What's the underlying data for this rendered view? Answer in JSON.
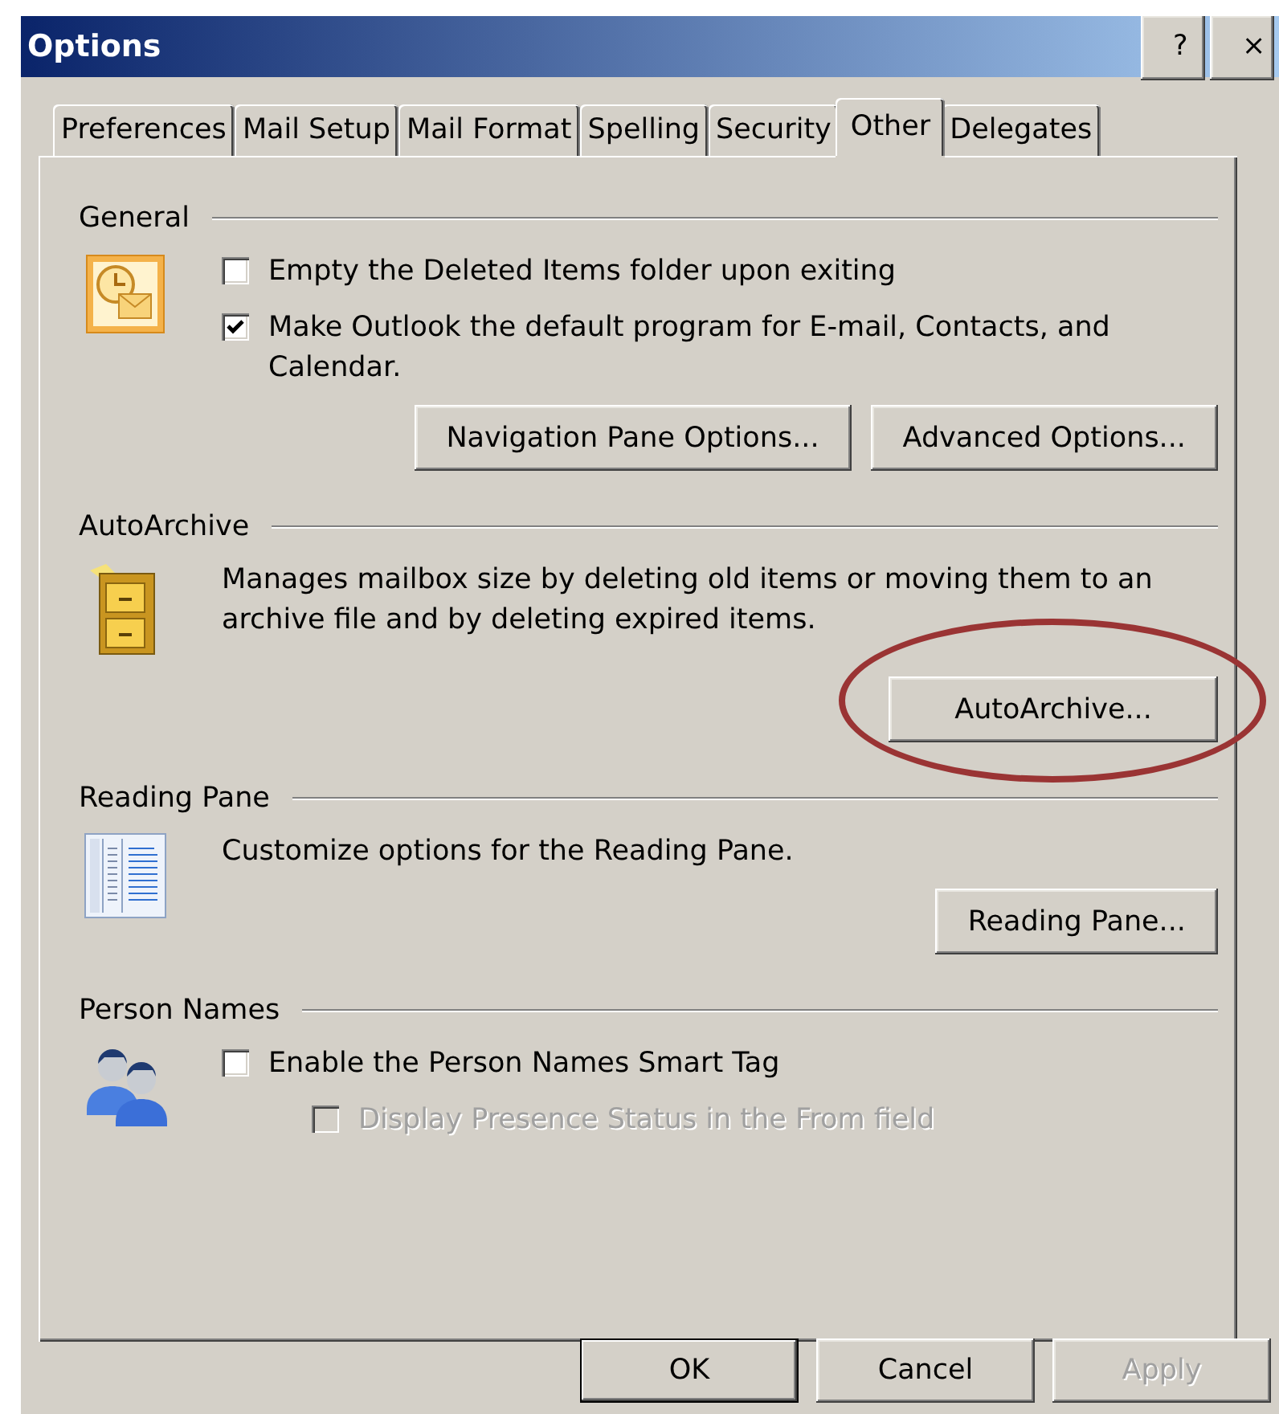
{
  "window": {
    "title": "Options",
    "title_buttons": [
      "?",
      "×"
    ]
  },
  "tabs": [
    {
      "label": "Preferences",
      "selected": false
    },
    {
      "label": "Mail Setup",
      "selected": false
    },
    {
      "label": "Mail Format",
      "selected": false
    },
    {
      "label": "Spelling",
      "selected": false
    },
    {
      "label": "Security",
      "selected": false
    },
    {
      "label": "Other",
      "selected": true
    },
    {
      "label": "Delegates",
      "selected": false
    }
  ],
  "sections": [
    {
      "title": "General",
      "kind": "general",
      "rows": [
        {
          "kind": "checkbox",
          "label": "Empty the Deleted Items folder upon exiting",
          "checked": false,
          "disabled": false
        },
        {
          "kind": "checkbox",
          "label": "Make Outlook the default program for E-mail, Contacts, and Calendar.",
          "checked": true,
          "disabled": false
        },
        {
          "kind": "buttons",
          "buttons": [
            "Navigation Pane Options...",
            "Advanced Options..."
          ]
        }
      ]
    },
    {
      "title": "AutoArchive",
      "kind": "autoarchive",
      "rows": [
        {
          "kind": "text",
          "text": "Manages mailbox size by deleting old items or moving them to an archive file and by deleting expired items."
        },
        {
          "kind": "buttons",
          "buttons": [
            "AutoArchive..."
          ],
          "highlighted": true
        }
      ]
    },
    {
      "title": "Reading Pane",
      "kind": "reading-pane",
      "rows": [
        {
          "kind": "text",
          "text": "Customize options for the Reading Pane."
        },
        {
          "kind": "buttons",
          "buttons": [
            "Reading Pane..."
          ]
        }
      ]
    },
    {
      "title": "Person Names",
      "kind": "person-names",
      "rows": [
        {
          "kind": "checkbox",
          "label": "Enable the Person Names Smart Tag",
          "checked": false,
          "disabled": false,
          "children": [
            {
              "kind": "checkbox",
              "label": "Display Presence Status in the From field",
              "checked": false,
              "disabled": true
            }
          ]
        }
      ]
    }
  ],
  "footer_buttons": [
    {
      "label": "OK",
      "default": true,
      "disabled": false
    },
    {
      "label": "Cancel",
      "default": false,
      "disabled": false
    },
    {
      "label": "Apply",
      "default": false,
      "disabled": true
    }
  ]
}
